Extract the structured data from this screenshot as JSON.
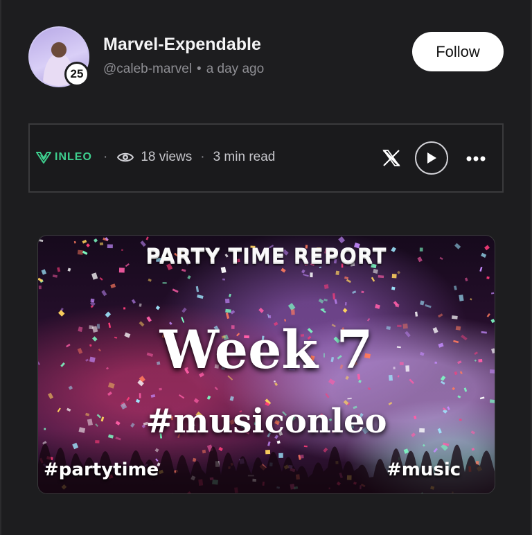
{
  "author": {
    "name": "Marvel-Expendable",
    "handle": "@caleb-marvel",
    "separator": "•",
    "posted": "a day ago",
    "reputation": "25"
  },
  "follow_label": "Follow",
  "post_bar": {
    "platform": "INLEO",
    "dot": "·",
    "views": "18 views",
    "read_time": "3 min read",
    "accent_color": "#3ecf8e"
  },
  "cover_image": {
    "title": "PARTY TIME REPORT",
    "week": "Week 7",
    "hashtag": "#musiconleo",
    "tag_left": "#partytime",
    "tag_right": "#music"
  },
  "icons": {
    "platform": "inleo-logo-icon",
    "views": "eye-icon",
    "share": "x-icon",
    "play": "play-icon",
    "more": "more-horizontal-icon"
  }
}
